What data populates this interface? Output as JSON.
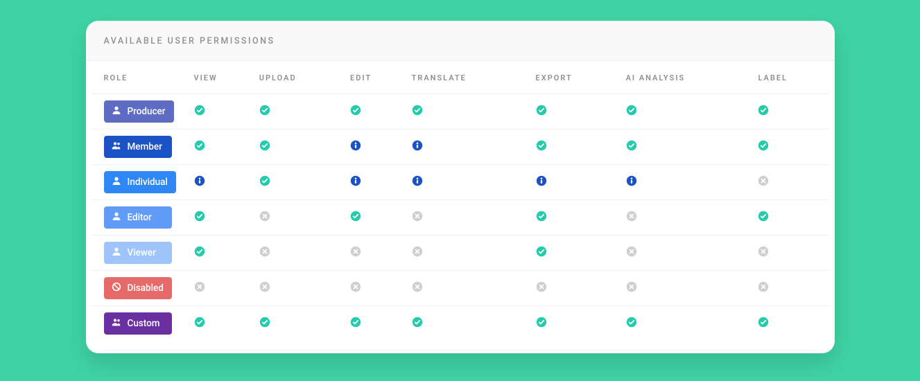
{
  "header": {
    "title": "AVAILABLE USER PERMISSIONS"
  },
  "columns": [
    "ROLE",
    "VIEW",
    "UPLOAD",
    "EDIT",
    "TRANSLATE",
    "EXPORT",
    "AI ANALYSIS",
    "LABEL"
  ],
  "status_colors": {
    "check": "#24ccab",
    "info": "#1b52c4",
    "cross": "#cfcfcf"
  },
  "roles": [
    {
      "id": "producer",
      "label": "Producer",
      "icon": "person",
      "bg": "#5f6cc4",
      "perms": [
        "check",
        "check",
        "check",
        "check",
        "check",
        "check",
        "check"
      ]
    },
    {
      "id": "member",
      "label": "Member",
      "icon": "people",
      "bg": "#1b52c4",
      "perms": [
        "check",
        "check",
        "info",
        "info",
        "check",
        "check",
        "check"
      ]
    },
    {
      "id": "individual",
      "label": "Individual",
      "icon": "person",
      "bg": "#2f87f6",
      "perms": [
        "info",
        "check",
        "info",
        "info",
        "info",
        "info",
        "cross"
      ]
    },
    {
      "id": "editor",
      "label": "Editor",
      "icon": "person",
      "bg": "#5f9bf7",
      "perms": [
        "check",
        "cross",
        "check",
        "cross",
        "check",
        "cross",
        "check"
      ]
    },
    {
      "id": "viewer",
      "label": "Viewer",
      "icon": "person",
      "bg": "#9ec4fb",
      "perms": [
        "check",
        "cross",
        "cross",
        "cross",
        "check",
        "cross",
        "cross"
      ]
    },
    {
      "id": "disabled",
      "label": "Disabled",
      "icon": "ban",
      "bg": "#e66a6a",
      "perms": [
        "cross",
        "cross",
        "cross",
        "cross",
        "cross",
        "cross",
        "cross"
      ]
    },
    {
      "id": "custom",
      "label": "Custom",
      "icon": "people",
      "bg": "#6a2fa0",
      "perms": [
        "check",
        "check",
        "check",
        "check",
        "check",
        "check",
        "check"
      ]
    }
  ]
}
